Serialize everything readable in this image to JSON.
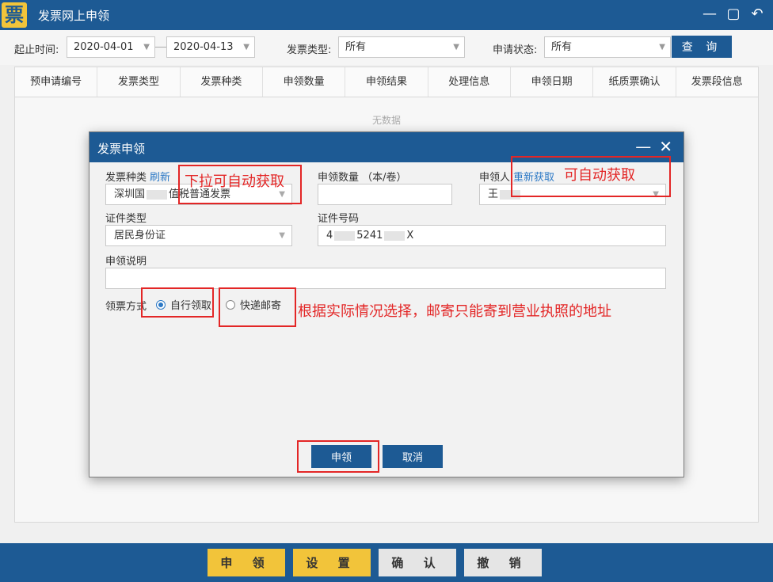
{
  "app": {
    "logo_char": "票",
    "title": "发票网上申领"
  },
  "filters": {
    "start_label": "起止时间:",
    "start_date": "2020-04-01",
    "end_date": "2020-04-13",
    "type_label": "发票类型:",
    "type_value": "所有",
    "status_label": "申请状态:",
    "status_value": "所有",
    "query_label": "查 询"
  },
  "table": {
    "columns": [
      "预申请编号",
      "发票类型",
      "发票种类",
      "申领数量",
      "申领结果",
      "处理信息",
      "申领日期",
      "纸质票确认",
      "发票段信息"
    ],
    "empty_text": "无数据"
  },
  "dialog": {
    "title": "发票申领",
    "invoice_kind_label": "发票种类",
    "refresh_link": "刷新",
    "invoice_kind_prefix": "深圳国",
    "invoice_kind_value": "值税普通发票",
    "quantity_label": "申领数量 （本/卷）",
    "quantity_value": "",
    "applicant_label": "申领人",
    "reacquire_link": "重新获取",
    "applicant_value": "王",
    "id_type_label": "证件类型",
    "id_type_value": "居民身份证",
    "id_number_label": "证件号码",
    "id_number_value": "4",
    "id_number_mid": "5241",
    "id_number_tail": "X",
    "remark_label": "申领说明",
    "remark_value": "",
    "receive_label": "领票方式",
    "option_self": "自行领取",
    "option_mail": "快递邮寄",
    "submit_label": "申领",
    "cancel_label": "取消"
  },
  "annotations": {
    "dropdown_note": "下拉可自动获取",
    "auto_note": "可自动获取",
    "mail_note": "根据实际情况选择，邮寄只能寄到营业执照的地址"
  },
  "bottom": {
    "apply": "申 领",
    "settings": "设 置",
    "confirm": "确 认",
    "revoke": "撤 销"
  }
}
